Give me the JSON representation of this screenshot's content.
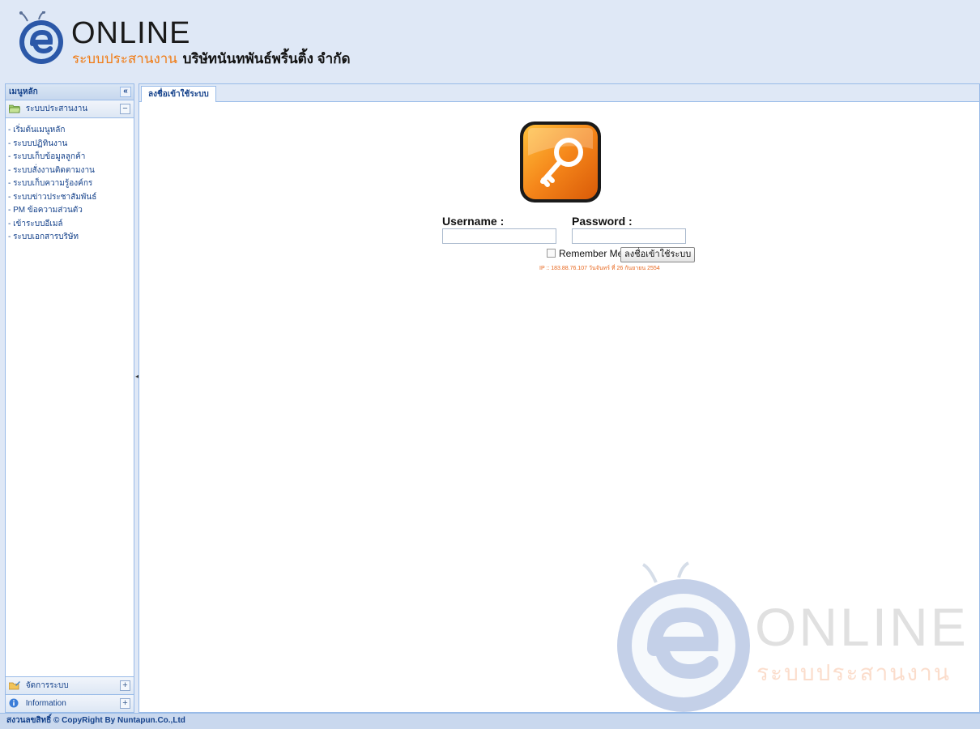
{
  "header": {
    "brand": "ONLINE",
    "system_label": "ระบบประสานงาน",
    "company": "บริษัทนันทพันธ์พริ้นติ้ง จำกัด"
  },
  "sidebar": {
    "title": "เมนูหลัก",
    "collapse_glyph": "«",
    "section": {
      "label": "ระบบประสานงาน",
      "toggle": "−",
      "items": [
        "- เริ่มต้นเมนูหลัก",
        "- ระบบปฏิทินงาน",
        "- ระบบเก็บข้อมูลลูกค้า",
        "- ระบบสั่งงานติดตามงาน",
        "- ระบบเก็บความรู้องค์กร",
        "- ระบบข่าวประชาสัมพันธ์",
        "- PM ข้อความส่วนตัว",
        "- เข้าระบบอีเมล์",
        "- ระบบเอกสารบริษัท"
      ]
    },
    "bottom_sections": [
      {
        "label": "จัดการระบบ",
        "toggle": "+"
      },
      {
        "label": "Information",
        "toggle": "+"
      }
    ]
  },
  "tabs": [
    {
      "label": "ลงชื่อเข้าใช้ระบบ",
      "active": true
    }
  ],
  "login": {
    "username_label": "Username :",
    "password_label": "Password :",
    "username_value": "",
    "password_value": "",
    "remember_label": "Remember Me",
    "remember_checked": false,
    "button_label": "ลงชื่อเข้าใช้ระบบ",
    "ip_text": "IP :: 183.88.76.107 วันจันทร์ ที่ 26 กันยายน 2554"
  },
  "watermark": {
    "brand": "ONLINE",
    "sub": "ระบบประสานงาน"
  },
  "footer": {
    "text": "สงวนลขสิทธิ์ © CopyRight By Nuntapun.Co.,Ltd"
  },
  "colors": {
    "accent_orange": "#f07a12",
    "panel_text": "#15428b",
    "panel_border": "#99bbe8",
    "background": "#dfe8f6"
  }
}
